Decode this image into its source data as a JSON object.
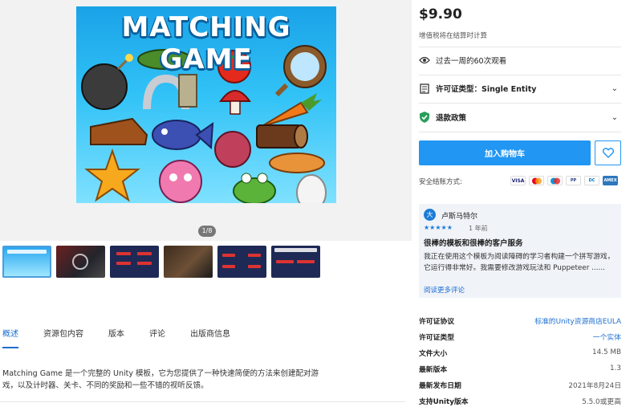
{
  "gallery": {
    "hero_title": "MATCHING GAME",
    "counter": "1/8"
  },
  "tabs": [
    {
      "label": "概述"
    },
    {
      "label": "资源包内容"
    },
    {
      "label": "版本"
    },
    {
      "label": "评论"
    },
    {
      "label": "出版商信息"
    }
  ],
  "description": "Matching Game 是一个完整的 Unity 模板，它为您提供了一种快速简便的方法来创建配对游戏，以及计时器、关卡、不同的奖励和一些不错的视听反馈。",
  "product": {
    "price": "$9.90",
    "tax_note": "增值税将在结算时计算",
    "views": "过去一周的60次观看",
    "license_type": "许可证类型：Single Entity",
    "refund": "退款政策",
    "add_to_cart": "加入购物车",
    "secure_payment": "安全结账方式:",
    "payment_methods": [
      "VISA",
      "MC",
      "MAE",
      "PP",
      "DC",
      "AMEX"
    ]
  },
  "review": {
    "avatar": "大",
    "author": "卢斯马特尔",
    "stars": "★★★★★",
    "time": "1 年前",
    "title": "很棒的模板和很棒的客户服务",
    "body": "我正在使用这个模板为阅读障碍的学习者构建一个拼写游戏，它运行得非常好。我需要修改游戏玩法和 Puppeteer ......",
    "more": "阅读更多评论"
  },
  "details": [
    {
      "key": "许可证协议",
      "value": "标准的Unity资源商店EULA",
      "link": true
    },
    {
      "key": "许可证类型",
      "value": "一个实体",
      "link": true
    },
    {
      "key": "文件大小",
      "value": "14.5 MB",
      "link": false
    },
    {
      "key": "最新版本",
      "value": "1.3",
      "link": false
    },
    {
      "key": "最新发布日期",
      "value": "2021年8月24日",
      "link": false
    },
    {
      "key": "支持Unity版本",
      "value": "5.5.0或更高",
      "link": false
    }
  ],
  "colors": {
    "accent": "#2196f3",
    "link": "#1c6fd1",
    "review_bg": "#f0f3f8"
  }
}
